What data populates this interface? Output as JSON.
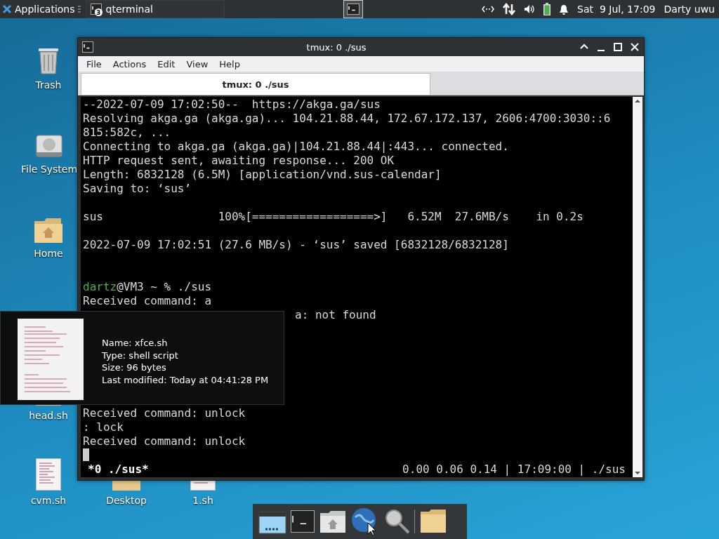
{
  "top_panel": {
    "applications_menu": "Applications",
    "tasks": [
      {
        "label": "qterminal",
        "badge": "3"
      }
    ],
    "clock": "Sat  9 Jul, 17:09",
    "user": "Darty uwu"
  },
  "desktop_icons": [
    {
      "label": "Trash",
      "kind": "trash"
    },
    {
      "label": "File System",
      "kind": "drive"
    },
    {
      "label": "Home",
      "kind": "home"
    },
    {
      "label": "head.sh",
      "kind": "script"
    },
    {
      "label": "cvm.sh",
      "kind": "script"
    },
    {
      "label": "Desktop",
      "kind": "folder"
    },
    {
      "label": "1.sh",
      "kind": "script"
    }
  ],
  "window": {
    "title": "tmux: 0 ./sus",
    "menu": [
      "File",
      "Actions",
      "Edit",
      "View",
      "Help"
    ],
    "tabs": [
      {
        "label": "tmux: 0 ./sus",
        "selected": true
      }
    ],
    "lines": [
      {
        "kind": "text",
        "text": "--2022-07-09 17:02:50--  https://akga.ga/sus"
      },
      {
        "kind": "text",
        "text": "Resolving akga.ga (akga.ga)... 104.21.88.44, 172.67.172.137, 2606:4700:3030::6"
      },
      {
        "kind": "text",
        "text": "815:582c, ..."
      },
      {
        "kind": "text",
        "text": "Connecting to akga.ga (akga.ga)|104.21.88.44|:443... connected."
      },
      {
        "kind": "text",
        "text": "HTTP request sent, awaiting response... 200 OK"
      },
      {
        "kind": "text",
        "text": "Length: 6832128 (6.5M) [application/vnd.sus-calendar]"
      },
      {
        "kind": "text",
        "text": "Saving to: ‘sus’"
      },
      {
        "kind": "blank"
      },
      {
        "kind": "text",
        "text": "sus                 100%[==================>]   6.52M  27.6MB/s    in 0.2s"
      },
      {
        "kind": "blank"
      },
      {
        "kind": "text",
        "text": "2022-07-09 17:02:51 (27.6 MB/s) - ‘sus’ saved [6832128/6832128]"
      },
      {
        "kind": "blank"
      },
      {
        "kind": "blank"
      },
      {
        "kind": "prompt",
        "user": "dartz",
        "text": "@VM3 ~ % ./sus"
      },
      {
        "kind": "text",
        "text": "Received command: a"
      },
      {
        "kind": "covered",
        "text": "a: not found"
      },
      {
        "kind": "blank"
      },
      {
        "kind": "blank"
      },
      {
        "kind": "blank"
      },
      {
        "kind": "blank"
      },
      {
        "kind": "blank"
      },
      {
        "kind": "blank"
      },
      {
        "kind": "text",
        "text": "Received command: unlock"
      },
      {
        "kind": "text",
        "text": ": lock"
      },
      {
        "kind": "text",
        "text": "Received command: unlock"
      },
      {
        "kind": "cursor"
      }
    ],
    "status_left": "*0 ./sus*",
    "status_right": "0.00 0.06 0.14 | 17:09:00 | ./sus"
  },
  "tooltip": {
    "lines": [
      "Name: xfce.sh",
      "Type: shell script",
      "Size: 96 bytes",
      "Last modified: Today at 04:41:28 PM"
    ]
  },
  "dock": [
    {
      "kind": "show-desktop"
    },
    {
      "kind": "terminal"
    },
    {
      "kind": "home-folder"
    },
    {
      "kind": "globe"
    },
    {
      "kind": "magnifier"
    },
    {
      "kind": "separator"
    },
    {
      "kind": "folder"
    }
  ]
}
